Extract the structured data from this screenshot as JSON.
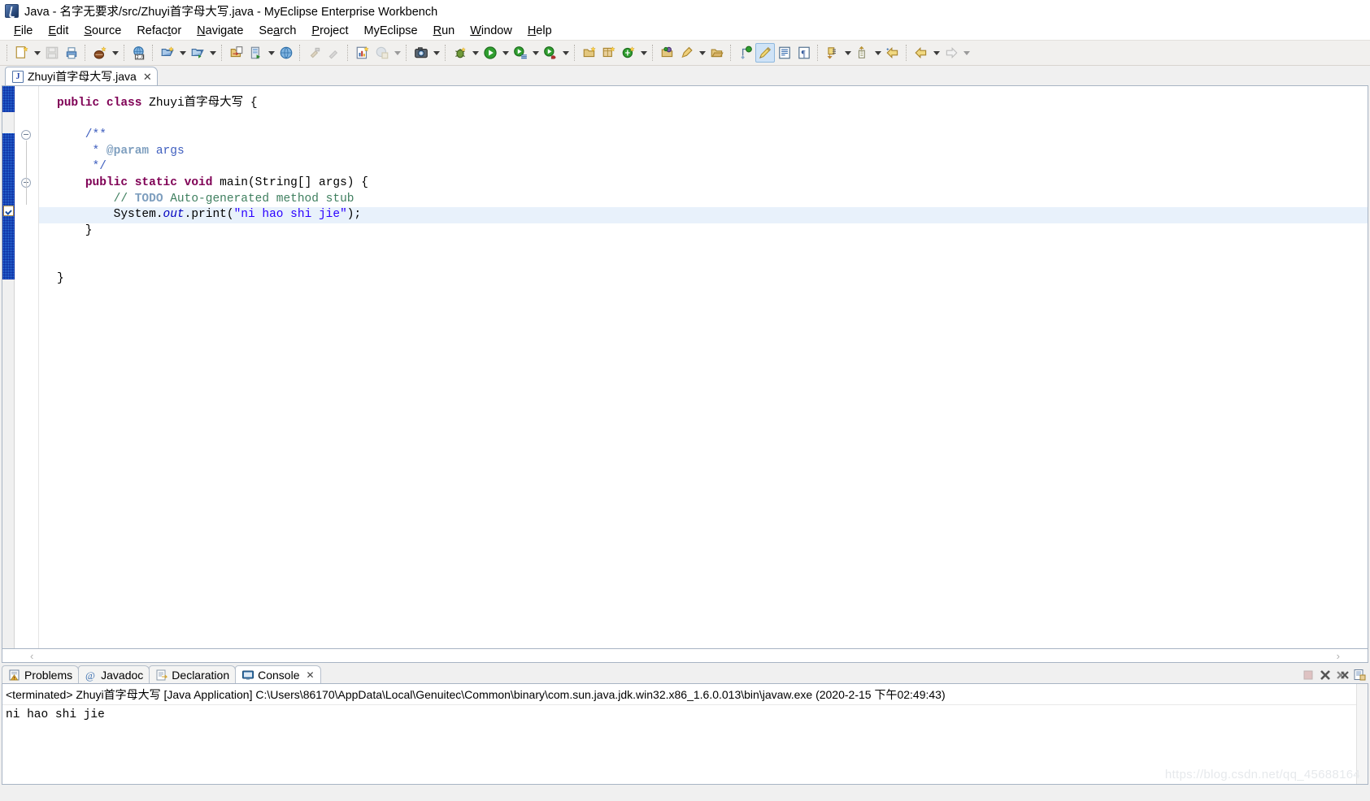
{
  "window": {
    "title": "Java - 名字无要求/src/Zhuyi首字母大写.java - MyEclipse Enterprise Workbench",
    "app_icon": "myeclipse-icon"
  },
  "menubar": {
    "items": [
      {
        "label": "File",
        "mnemonic": "F"
      },
      {
        "label": "Edit",
        "mnemonic": "E"
      },
      {
        "label": "Source",
        "mnemonic": "S"
      },
      {
        "label": "Refactor",
        "mnemonic": "t"
      },
      {
        "label": "Navigate",
        "mnemonic": "N"
      },
      {
        "label": "Search",
        "mnemonic": "a"
      },
      {
        "label": "Project",
        "mnemonic": "P"
      },
      {
        "label": "MyEclipse",
        "mnemonic": ""
      },
      {
        "label": "Run",
        "mnemonic": "R"
      },
      {
        "label": "Window",
        "mnemonic": "W"
      },
      {
        "label": "Help",
        "mnemonic": "H"
      }
    ]
  },
  "toolbar": {
    "groups": [
      {
        "buttons": [
          {
            "name": "new-wizard-icon",
            "arrow": true,
            "enabled": true
          },
          {
            "name": "save-icon",
            "arrow": false,
            "enabled": false
          },
          {
            "name": "print-icon",
            "arrow": false,
            "enabled": true
          }
        ]
      },
      {
        "buttons": [
          {
            "name": "new-java-project-icon",
            "arrow": true,
            "enabled": true
          }
        ]
      },
      {
        "buttons": [
          {
            "name": "open-web-browser-icon",
            "arrow": false,
            "enabled": true
          }
        ]
      },
      {
        "buttons": [
          {
            "name": "new-deployment-icon",
            "arrow": true,
            "enabled": true
          },
          {
            "name": "deploy-manager-icon",
            "arrow": true,
            "enabled": true
          }
        ]
      },
      {
        "buttons": [
          {
            "name": "import-icon",
            "arrow": false,
            "enabled": true
          },
          {
            "name": "server-run-icon",
            "arrow": true,
            "enabled": true
          },
          {
            "name": "open-browser-globe-icon",
            "arrow": false,
            "enabled": true
          }
        ]
      },
      {
        "buttons": [
          {
            "name": "build-all-icon",
            "arrow": false,
            "enabled": false
          },
          {
            "name": "build-project-icon",
            "arrow": false,
            "enabled": false
          }
        ]
      },
      {
        "buttons": [
          {
            "name": "report-designer-icon",
            "arrow": false,
            "enabled": true
          },
          {
            "name": "web-report-icon",
            "arrow": true,
            "enabled": false
          }
        ]
      },
      {
        "buttons": [
          {
            "name": "snapshot-camera-icon",
            "arrow": true,
            "enabled": true
          }
        ]
      },
      {
        "buttons": [
          {
            "name": "debug-icon",
            "arrow": true,
            "enabled": true
          },
          {
            "name": "run-icon",
            "arrow": true,
            "enabled": true
          },
          {
            "name": "run-history-icon",
            "arrow": true,
            "enabled": true
          },
          {
            "name": "run-external-tools-icon",
            "arrow": true,
            "enabled": true
          }
        ]
      },
      {
        "buttons": [
          {
            "name": "new-package-icon",
            "arrow": false,
            "enabled": true
          },
          {
            "name": "new-class-icon",
            "arrow": false,
            "enabled": true
          },
          {
            "name": "new-generic-icon",
            "arrow": true,
            "enabled": true
          }
        ]
      },
      {
        "buttons": [
          {
            "name": "open-type-icon",
            "arrow": false,
            "enabled": true
          },
          {
            "name": "search-icon",
            "arrow": true,
            "enabled": true
          },
          {
            "name": "open-resource-icon",
            "arrow": false,
            "enabled": true
          }
        ]
      },
      {
        "buttons": [
          {
            "name": "toggle-mark-occurrences-icon",
            "arrow": false,
            "enabled": true
          },
          {
            "name": "pencil-highlight-icon",
            "arrow": false,
            "enabled": true,
            "active": true
          },
          {
            "name": "show-whitespace-icon",
            "arrow": false,
            "enabled": true
          },
          {
            "name": "pilcrow-icon",
            "arrow": false,
            "enabled": true
          }
        ]
      },
      {
        "buttons": [
          {
            "name": "next-annotation-icon",
            "arrow": true,
            "enabled": true
          },
          {
            "name": "previous-annotation-icon",
            "arrow": true,
            "enabled": true
          },
          {
            "name": "last-edit-location-icon",
            "arrow": false,
            "enabled": true
          }
        ]
      },
      {
        "buttons": [
          {
            "name": "back-icon",
            "arrow": true,
            "enabled": true
          },
          {
            "name": "forward-icon",
            "arrow": true,
            "enabled": false
          }
        ]
      }
    ]
  },
  "editor": {
    "tab": {
      "label": "Zhuyi首字母大写.java",
      "icon": "java-file-icon",
      "close": "✕",
      "file_letter": "J"
    },
    "scroll_left_arrow": "‹",
    "scroll_right_arrow": "›",
    "code_lines": [
      {
        "segments": [
          {
            "t": "public",
            "c": "kw"
          },
          {
            "t": " ",
            "c": ""
          },
          {
            "t": "class",
            "c": "kw"
          },
          {
            "t": " Zhuyi首字母大写 {",
            "c": ""
          }
        ]
      },
      {
        "segments": [
          {
            "t": "",
            "c": ""
          }
        ]
      },
      {
        "segments": [
          {
            "t": "    /**",
            "c": "jdoc"
          }
        ]
      },
      {
        "segments": [
          {
            "t": "     * ",
            "c": "jdoc"
          },
          {
            "t": "@param",
            "c": "jdoc-tag"
          },
          {
            "t": " args",
            "c": "jdoc"
          }
        ]
      },
      {
        "segments": [
          {
            "t": "     */",
            "c": "jdoc"
          }
        ]
      },
      {
        "segments": [
          {
            "t": "    ",
            "c": ""
          },
          {
            "t": "public",
            "c": "kw"
          },
          {
            "t": " ",
            "c": ""
          },
          {
            "t": "static",
            "c": "kw"
          },
          {
            "t": " ",
            "c": ""
          },
          {
            "t": "void",
            "c": "kw"
          },
          {
            "t": " main(String[] args) {",
            "c": ""
          }
        ]
      },
      {
        "segments": [
          {
            "t": "        // ",
            "c": "cmt"
          },
          {
            "t": "TODO",
            "c": "todo"
          },
          {
            "t": " Auto-generated method stub",
            "c": "cmt"
          }
        ]
      },
      {
        "segments": [
          {
            "t": "        System.",
            "c": ""
          },
          {
            "t": "out",
            "c": "fld"
          },
          {
            "t": ".print(",
            "c": ""
          },
          {
            "t": "\"ni hao shi jie\"",
            "c": "str"
          },
          {
            "t": ");",
            "c": ""
          }
        ]
      },
      {
        "segments": [
          {
            "t": "    }",
            "c": ""
          }
        ]
      },
      {
        "segments": [
          {
            "t": "",
            "c": ""
          }
        ]
      },
      {
        "segments": [
          {
            "t": "",
            "c": ""
          }
        ]
      },
      {
        "segments": [
          {
            "t": "}",
            "c": ""
          }
        ]
      }
    ],
    "highlighted_line_index": 7,
    "fold_marker_line_indexes": [
      2,
      5
    ],
    "task_marker_line_index": 6
  },
  "bottom_panel": {
    "tabs": [
      {
        "label": "Problems",
        "icon": "problems-icon",
        "active": false,
        "closeable": false
      },
      {
        "label": "Javadoc",
        "icon": "javadoc-at-icon",
        "active": false,
        "closeable": false
      },
      {
        "label": "Declaration",
        "icon": "declaration-icon",
        "active": false,
        "closeable": false
      },
      {
        "label": "Console",
        "icon": "console-icon",
        "active": true,
        "closeable": true,
        "close": "✕"
      }
    ],
    "tools": [
      {
        "name": "terminate-icon",
        "enabled": false
      },
      {
        "name": "remove-launch-icon",
        "enabled": true
      },
      {
        "name": "remove-all-terminated-icon",
        "enabled": true
      },
      {
        "name": "open-console-icon",
        "enabled": true
      }
    ],
    "console": {
      "header": "<terminated> Zhuyi首字母大写 [Java Application] C:\\Users\\86170\\AppData\\Local\\Genuitec\\Common\\binary\\com.sun.java.jdk.win32.x86_1.6.0.013\\bin\\javaw.exe (2020-2-15 下午02:49:43)",
      "output": "ni hao shi jie"
    }
  },
  "watermark": {
    "text": "https://blog.csdn.net/qq_45688164"
  },
  "colors": {
    "keyword": "#7F0055",
    "comment": "#3F7F5F",
    "javadoc": "#3F5FBF",
    "string": "#2A00FF",
    "field": "#0000C0",
    "current_line": "#E8F1FB",
    "annotation_bar": "#2F7DDB",
    "toolbar_bg": "#F1F0EE",
    "active_toggle": "#CFE3F7"
  }
}
